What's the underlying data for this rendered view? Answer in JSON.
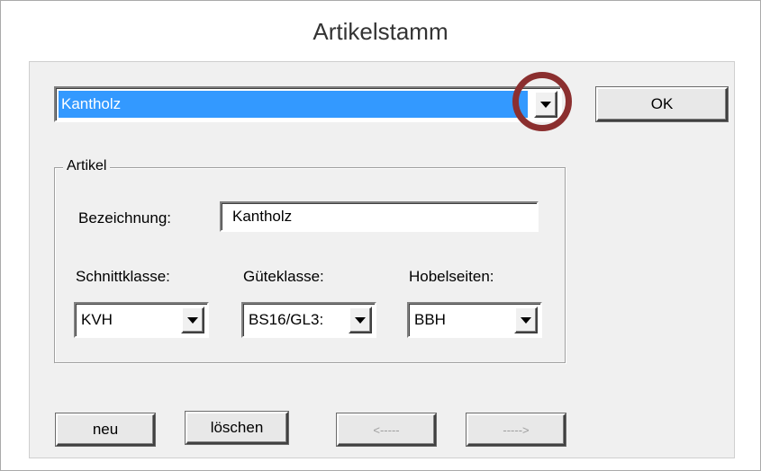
{
  "window": {
    "title": "Artikelstamm"
  },
  "article_select": {
    "value": "Kantholz"
  },
  "buttons": {
    "ok": "OK",
    "new": "neu",
    "delete": "löschen",
    "prev": "<-----",
    "next": "----->"
  },
  "group": {
    "legend": "Artikel",
    "bezeichnung_label": "Bezeichnung:",
    "bezeichnung_value": "Kantholz",
    "schnittklasse_label": "Schnittklasse:",
    "schnittklasse_value": "KVH",
    "gueteklasse_label": "Güteklasse:",
    "gueteklasse_value": "BS16/GL3:",
    "hobelseiten_label": "Hobelseiten:",
    "hobelseiten_value": "BBH"
  },
  "colors": {
    "selection": "#3399ff",
    "highlight_ring": "#8b2f2f"
  }
}
